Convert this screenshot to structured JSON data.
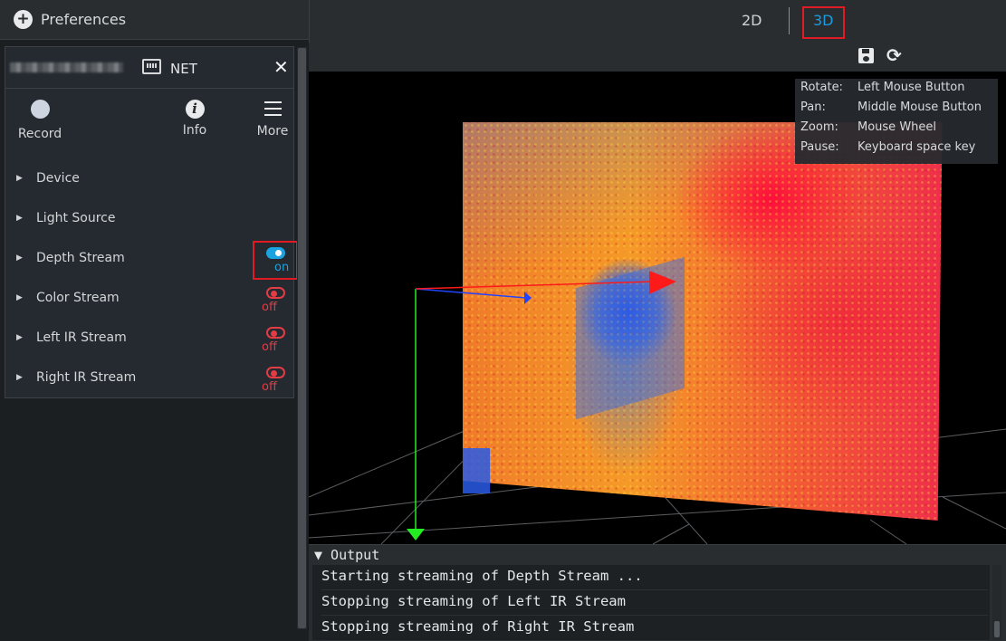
{
  "preferences": {
    "title": "Preferences",
    "plus_icon": "plus-circle-icon"
  },
  "device_panel": {
    "connection_label": "NET",
    "connection_icon": "network-port-icon",
    "close_glyph": "✕",
    "tools": [
      {
        "label": "Record",
        "icon": "record-icon"
      },
      {
        "label": "Info",
        "icon": "info-icon",
        "glyph": "i"
      },
      {
        "label": "More",
        "icon": "menu-icon"
      }
    ],
    "rows": [
      {
        "label": "Device"
      },
      {
        "label": "Light Source"
      },
      {
        "label": "Depth Stream",
        "state": "on"
      },
      {
        "label": "Color Stream",
        "state": "off"
      },
      {
        "label": "Left IR Stream",
        "state": "off"
      },
      {
        "label": "Right IR Stream",
        "state": "off"
      }
    ],
    "expand_glyph": "▶"
  },
  "view_tabs": {
    "tab_2d": "2D",
    "tab_3d": "3D",
    "active": "3D"
  },
  "toolbar": {
    "save_icon": "save-icon",
    "refresh_glyph": "⟳"
  },
  "controls_hint": [
    {
      "key": "Rotate:",
      "value": "Left Mouse Button"
    },
    {
      "key": "Pan:",
      "value": "Middle Mouse Button"
    },
    {
      "key": "Zoom:",
      "value": "Mouse Wheel"
    },
    {
      "key": "Pause:",
      "value": "Keyboard space key"
    }
  ],
  "output": {
    "title": "▼ Output",
    "lines": [
      "Starting streaming of Depth Stream ...",
      "Stopping streaming of Left IR Stream",
      "Stopping streaming of Right IR Stream"
    ]
  },
  "colors": {
    "accent": "#1aa3e0",
    "off": "#e33c44",
    "highlight": "#e01b24"
  }
}
